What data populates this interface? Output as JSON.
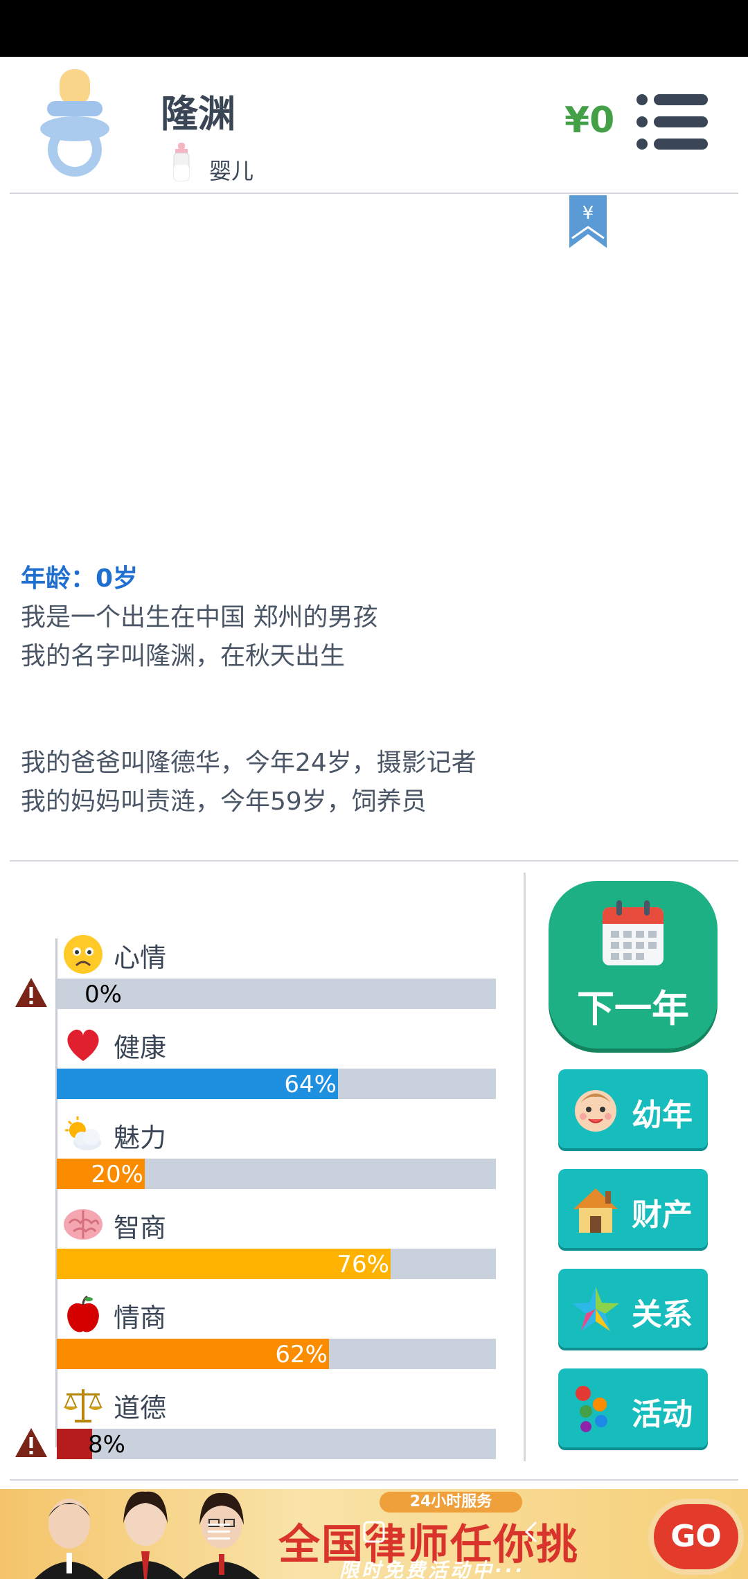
{
  "header": {
    "name": "隆渊",
    "stage": "婴儿",
    "money": "¥0",
    "bookmark_symbol": "¥"
  },
  "story": {
    "age_line": "年龄：0岁",
    "line1": "我是一个出生在中国 郑州的男孩",
    "line2": "我的名字叫隆渊，在秋天出生",
    "line3": "我的爸爸叫隆德华，今年24岁，摄影记者",
    "line4": "我的妈妈叫责涟，今年59岁，饲养员"
  },
  "stats": [
    {
      "label": "心情",
      "percent_text": "0%",
      "value": 0,
      "color": "#c9d1dc",
      "warning": true,
      "icon": "sad-face-icon"
    },
    {
      "label": "健康",
      "percent_text": "64%",
      "value": 64,
      "color": "#1f8fe0",
      "warning": false,
      "icon": "heart-icon"
    },
    {
      "label": "魅力",
      "percent_text": "20%",
      "value": 20,
      "color": "#fb8c00",
      "warning": false,
      "icon": "sun-cloud-icon"
    },
    {
      "label": "智商",
      "percent_text": "76%",
      "value": 76,
      "color": "#ffb300",
      "warning": false,
      "icon": "brain-icon"
    },
    {
      "label": "情商",
      "percent_text": "62%",
      "value": 62,
      "color": "#fb8c00",
      "warning": false,
      "icon": "apple-icon"
    },
    {
      "label": "道德",
      "percent_text": "8%",
      "value": 8,
      "color": "#b71c1c",
      "warning": true,
      "icon": "scales-icon"
    }
  ],
  "buttons": {
    "next_year": "下一年",
    "childhood": "幼年",
    "property": "财产",
    "relations": "关系",
    "activities": "活动"
  },
  "ad": {
    "badge": "24小时服务",
    "title": "全国律师任你挑",
    "subtitle": "限时免费活动中···",
    "go": "GO"
  }
}
